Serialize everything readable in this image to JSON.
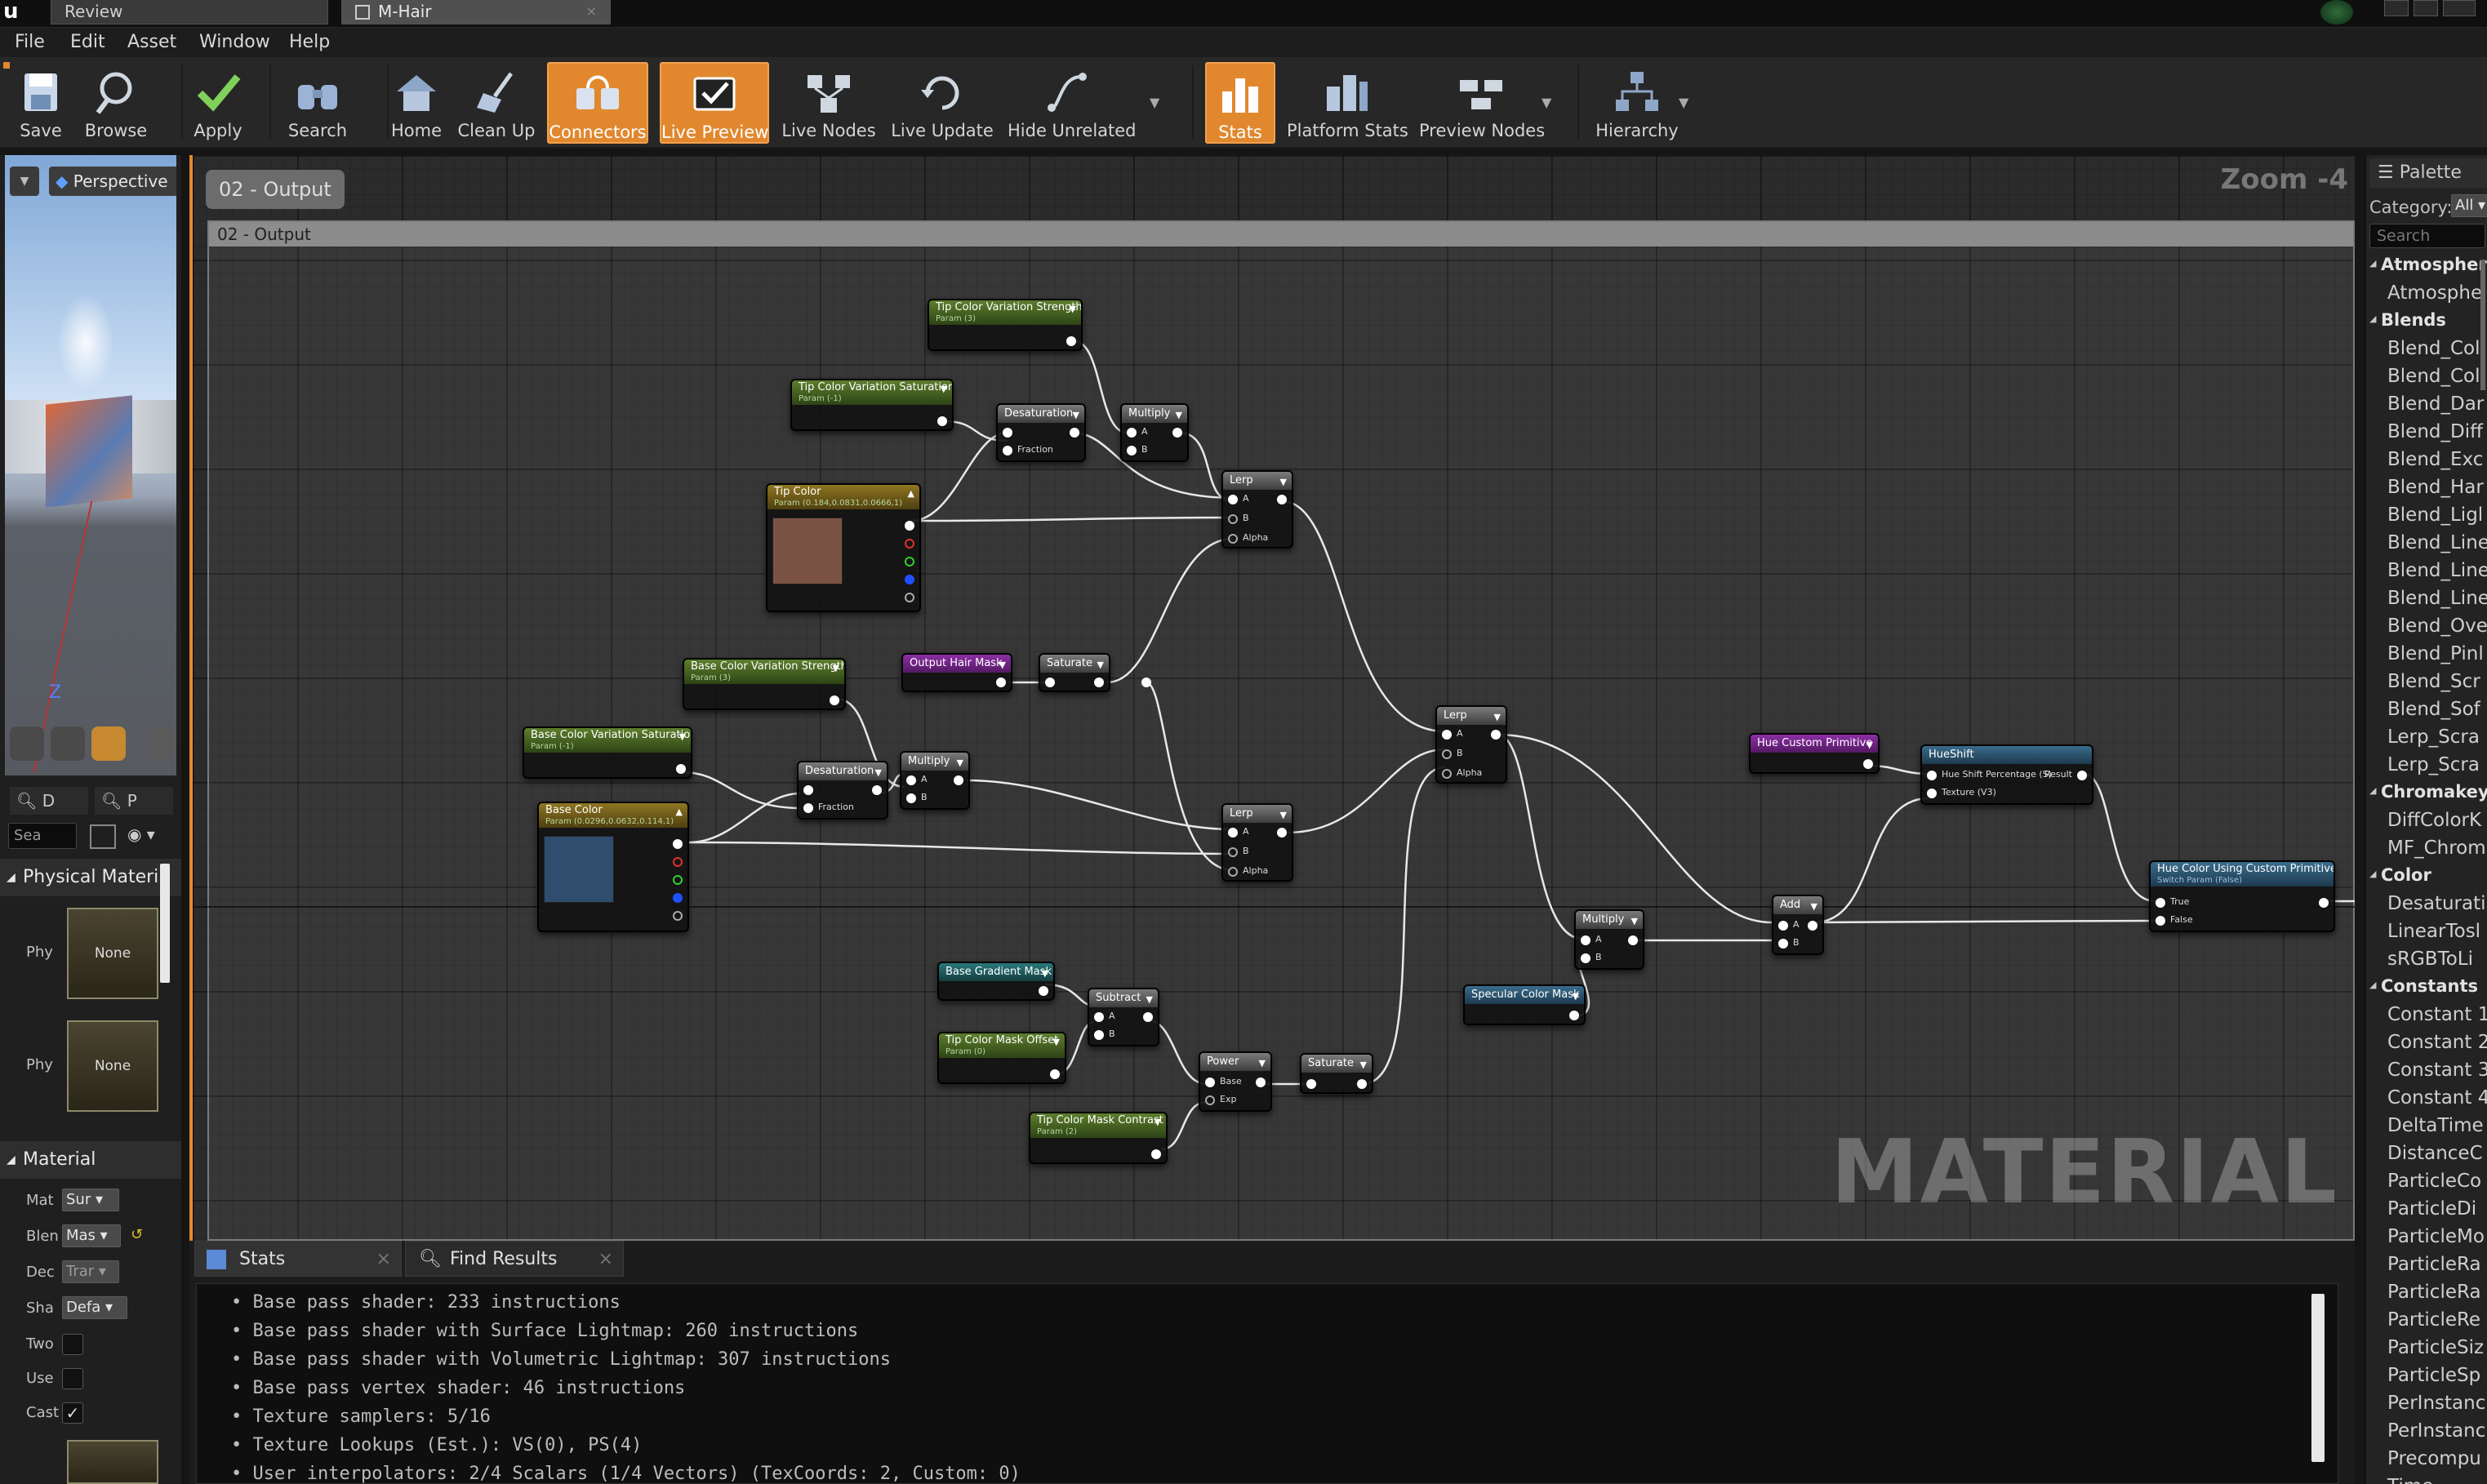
{
  "tabs": [
    {
      "label": "Review"
    },
    {
      "label": "M-Hair"
    }
  ],
  "menu": [
    "File",
    "Edit",
    "Asset",
    "Window",
    "Help"
  ],
  "toolbar": [
    {
      "label": "Save",
      "icon": "save-icon",
      "active": false
    },
    {
      "label": "Browse",
      "icon": "browse-icon",
      "active": false
    },
    {
      "label": "Apply",
      "icon": "check-icon",
      "active": false
    },
    {
      "label": "Search",
      "icon": "search-binoculars-icon",
      "active": false
    },
    {
      "label": "Home",
      "icon": "home-icon",
      "active": false
    },
    {
      "label": "Clean Up",
      "icon": "broom-icon",
      "active": false
    },
    {
      "label": "Connectors",
      "icon": "connectors-icon",
      "active": true
    },
    {
      "label": "Live Preview",
      "icon": "live-preview-icon",
      "active": true
    },
    {
      "label": "Live Nodes",
      "icon": "live-nodes-icon",
      "active": false
    },
    {
      "label": "Live Update",
      "icon": "live-update-icon",
      "active": false
    },
    {
      "label": "Hide Unrelated",
      "icon": "hide-unrelated-icon",
      "active": false
    },
    {
      "label": "Stats",
      "icon": "stats-icon",
      "active": true
    },
    {
      "label": "Platform Stats",
      "icon": "platform-stats-icon",
      "active": false
    },
    {
      "label": "Preview Nodes",
      "icon": "preview-nodes-icon",
      "active": false
    },
    {
      "label": "Hierarchy",
      "icon": "hierarchy-icon",
      "active": false
    }
  ],
  "viewport": {
    "mode": "Perspective",
    "axis_label": "Z"
  },
  "details": {
    "search_placeholder": "Sea",
    "tab1": "D",
    "tab2": "P",
    "physical_material_header": "Physical Materi",
    "phys_label": "Phy",
    "none_label": "None",
    "material_header": "Material",
    "rows": [
      {
        "label": "Mat",
        "value": "Sur"
      },
      {
        "label": "Blen",
        "value": "Mas"
      },
      {
        "label": "Dec",
        "value": "Trar"
      },
      {
        "label": "Sha",
        "value": "Defa"
      }
    ],
    "checks": [
      {
        "label": "Two",
        "checked": false
      },
      {
        "label": "Use",
        "checked": false
      },
      {
        "label": "Cast",
        "checked": true
      }
    ]
  },
  "graph": {
    "output_badge": "02 - Output",
    "comment_title": "02 - Output",
    "zoom": "Zoom -4",
    "watermark": "MATERIAL"
  },
  "nodes": {
    "tip_strength": {
      "title": "Tip Color Variation Strength",
      "sub": "Param (3)"
    },
    "tip_saturation": {
      "title": "Tip Color Variation Saturation",
      "sub": "Param (-1)"
    },
    "desat1": {
      "title": "Desaturation",
      "pin": "Fraction"
    },
    "mult1": {
      "title": "Multiply",
      "a": "A",
      "b": "B"
    },
    "tip_color": {
      "title": "Tip Color",
      "sub": "Param (0.184,0.0831,0.0666,1)",
      "color": "#7b5345"
    },
    "lerp1": {
      "title": "Lerp",
      "a": "A",
      "b": "B",
      "alpha": "Alpha"
    },
    "output_hair_mask": {
      "title": "Output Hair Mask"
    },
    "saturate1": {
      "title": "Saturate"
    },
    "base_strength": {
      "title": "Base Color Variation Strength",
      "sub": "Param (3)"
    },
    "base_saturation": {
      "title": "Base Color Variation Saturation",
      "sub": "Param (-1)"
    },
    "desat2": {
      "title": "Desaturation",
      "pin": "Fraction"
    },
    "mult2": {
      "title": "Multiply",
      "a": "A",
      "b": "B"
    },
    "base_color": {
      "title": "Base Color",
      "sub": "Param (0.0296,0.0632,0.114,1)",
      "color": "#2f4d6d"
    },
    "lerp2": {
      "title": "Lerp",
      "a": "A",
      "b": "B",
      "alpha": "Alpha"
    },
    "lerp3": {
      "title": "Lerp",
      "a": "A",
      "b": "B",
      "alpha": "Alpha"
    },
    "base_gradient_mask": {
      "title": "Base Gradient Mask"
    },
    "subtract": {
      "title": "Subtract",
      "a": "A",
      "b": "B"
    },
    "tip_mask_offset": {
      "title": "Tip Color Mask Offset",
      "sub": "Param (0)"
    },
    "power": {
      "title": "Power",
      "a": "Base",
      "b": "Exp"
    },
    "saturate2": {
      "title": "Saturate"
    },
    "tip_mask_contrast": {
      "title": "Tip Color Mask Contrast",
      "sub": "Param (2)"
    },
    "mult3": {
      "title": "Multiply",
      "a": "A",
      "b": "B"
    },
    "specular_color_mask": {
      "title": "Specular Color Mask"
    },
    "hue_custom_primitive": {
      "title": "Hue Custom Primitive"
    },
    "hueshift": {
      "title": "HueShift",
      "a": "Hue Shift Percentage (S)",
      "result": "Result",
      "b": "Texture (V3)"
    },
    "add": {
      "title": "Add",
      "a": "A",
      "b": "B"
    },
    "hue_switch": {
      "title": "Hue Color Using Custom Primitive",
      "sub": "Switch Param (False)",
      "a": "True",
      "b": "False"
    }
  },
  "bottom": {
    "tabs": [
      "Stats",
      "Find Results"
    ],
    "stats": [
      "Base pass shader: 233 instructions",
      "Base pass shader with Surface Lightmap: 260 instructions",
      "Base pass shader with Volumetric Lightmap: 307 instructions",
      "Base pass vertex shader: 46 instructions",
      "Texture samplers: 5/16",
      "Texture Lookups (Est.): VS(0), PS(4)",
      "User interpolators: 2/4 Scalars (1/4 Vectors) (TexCoords: 2, Custom: 0)"
    ]
  },
  "palette": {
    "title": "Palette",
    "category_label": "Category:",
    "category_value": "All",
    "search_placeholder": "Search",
    "entries": [
      {
        "t": "cat",
        "label": "Atmosphere"
      },
      {
        "t": "item",
        "label": "Atmosphe"
      },
      {
        "t": "cat",
        "label": "Blends"
      },
      {
        "t": "item",
        "label": "Blend_Col"
      },
      {
        "t": "item",
        "label": "Blend_Col"
      },
      {
        "t": "item",
        "label": "Blend_Dar"
      },
      {
        "t": "item",
        "label": "Blend_Diff"
      },
      {
        "t": "item",
        "label": "Blend_Exc"
      },
      {
        "t": "item",
        "label": "Blend_Har"
      },
      {
        "t": "item",
        "label": "Blend_Ligl"
      },
      {
        "t": "item",
        "label": "Blend_Line"
      },
      {
        "t": "item",
        "label": "Blend_Line"
      },
      {
        "t": "item",
        "label": "Blend_Line"
      },
      {
        "t": "item",
        "label": "Blend_Ove"
      },
      {
        "t": "item",
        "label": "Blend_Pinl"
      },
      {
        "t": "item",
        "label": "Blend_Scr"
      },
      {
        "t": "item",
        "label": "Blend_Sof"
      },
      {
        "t": "item",
        "label": "Lerp_Scra"
      },
      {
        "t": "item",
        "label": "Lerp_Scra"
      },
      {
        "t": "cat",
        "label": "Chromakeyi"
      },
      {
        "t": "item",
        "label": "DiffColorK"
      },
      {
        "t": "item",
        "label": "MF_Chrom"
      },
      {
        "t": "cat",
        "label": "Color"
      },
      {
        "t": "item",
        "label": "Desaturati"
      },
      {
        "t": "item",
        "label": "LinearTosl"
      },
      {
        "t": "item",
        "label": "sRGBToLi"
      },
      {
        "t": "cat",
        "label": "Constants"
      },
      {
        "t": "item",
        "label": "Constant 1"
      },
      {
        "t": "item",
        "label": "Constant 2"
      },
      {
        "t": "item",
        "label": "Constant 3"
      },
      {
        "t": "item",
        "label": "Constant 4"
      },
      {
        "t": "item",
        "label": "DeltaTime"
      },
      {
        "t": "item",
        "label": "DistanceC"
      },
      {
        "t": "item",
        "label": "ParticleCo"
      },
      {
        "t": "item",
        "label": "ParticleDi"
      },
      {
        "t": "item",
        "label": "ParticleMo"
      },
      {
        "t": "item",
        "label": "ParticleRa"
      },
      {
        "t": "item",
        "label": "ParticleRa"
      },
      {
        "t": "item",
        "label": "ParticleRe"
      },
      {
        "t": "item",
        "label": "ParticleSiz"
      },
      {
        "t": "item",
        "label": "ParticleSp"
      },
      {
        "t": "item",
        "label": "PerInstanc"
      },
      {
        "t": "item",
        "label": "PerInstanc"
      },
      {
        "t": "item",
        "label": "Precompu"
      },
      {
        "t": "item",
        "label": "Time"
      }
    ]
  }
}
